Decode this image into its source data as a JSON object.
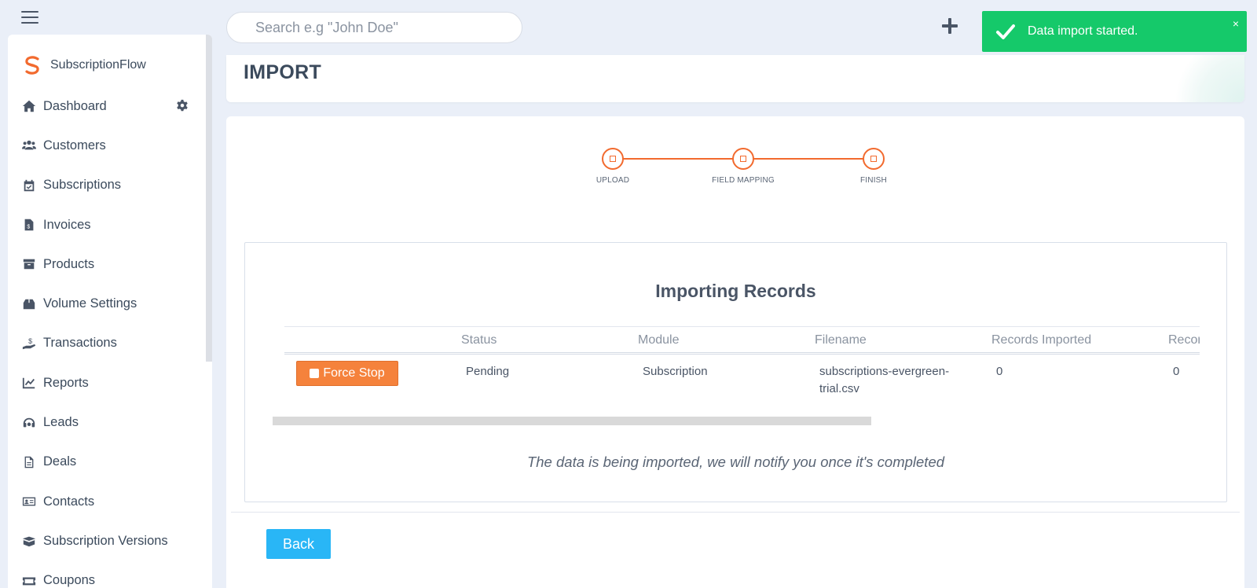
{
  "app": {
    "brand_name": "SubscriptionFlow"
  },
  "topbar": {
    "search_placeholder": "Search e.g \"John Doe\"",
    "add_icon": "plus-icon",
    "menu_icon": "hamburger-icon"
  },
  "toast": {
    "message": "Data import started.",
    "close_label": "×",
    "color": "#15c96a"
  },
  "sidebar": {
    "items": [
      {
        "label": "Dashboard",
        "icon": "home-icon"
      },
      {
        "label": "Customers",
        "icon": "users-icon"
      },
      {
        "label": "Subscriptions",
        "icon": "calendar-check-icon"
      },
      {
        "label": "Invoices",
        "icon": "invoice-icon"
      },
      {
        "label": "Products",
        "icon": "archive-icon"
      },
      {
        "label": "Volume Settings",
        "icon": "box-icon"
      },
      {
        "label": "Transactions",
        "icon": "hand-dollar-icon"
      },
      {
        "label": "Reports",
        "icon": "chart-line-icon"
      },
      {
        "label": "Leads",
        "icon": "headset-icon"
      },
      {
        "label": "Deals",
        "icon": "file-icon"
      },
      {
        "label": "Contacts",
        "icon": "address-card-icon"
      },
      {
        "label": "Subscription Versions",
        "icon": "boxes-icon"
      },
      {
        "label": "Coupons",
        "icon": "ticket-icon"
      }
    ]
  },
  "page": {
    "title": "IMPORT"
  },
  "stepper": {
    "steps": [
      {
        "label": "UPLOAD"
      },
      {
        "label": "FIELD MAPPING"
      },
      {
        "label": "FINISH"
      }
    ],
    "accent": "#f26a2e"
  },
  "import_panel": {
    "title": "Importing Records",
    "columns": [
      "",
      "Status",
      "Module",
      "Filename",
      "Records Imported",
      "Records"
    ],
    "row": {
      "action_label": "Force Stop",
      "status": "Pending",
      "module": "Subscription",
      "filename_line1": "subscriptions-evergreen-",
      "filename_line2": "trial.csv",
      "records_imported": "0",
      "records": "0"
    },
    "note": "The data is being imported, we will notify you once it's completed"
  },
  "footer": {
    "back_label": "Back"
  }
}
